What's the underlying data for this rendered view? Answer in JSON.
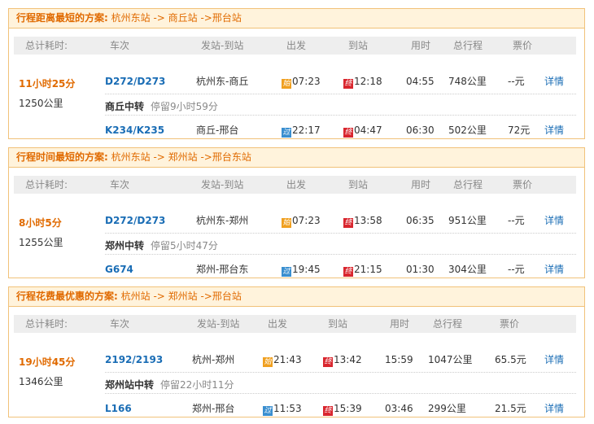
{
  "plans": [
    {
      "title": "行程距离最短的方案:",
      "route": "杭州东站 -> 商丘站 ->邢台站",
      "headers": [
        "总计耗时:",
        "车次",
        "发站-到站",
        "出发",
        "到站",
        "用时",
        "总行程",
        "票价"
      ],
      "total_time": "11小时25分",
      "total_km": "1250公里",
      "transfer_station": "商丘中转",
      "transfer_stay": "停留9小时59分",
      "legs": [
        {
          "train": "D272/D273",
          "stations": "杭州东-商丘",
          "dep_badge": "始",
          "dep": "07:23",
          "arr_badge": "终",
          "arr": "12:18",
          "duration": "04:55",
          "distance": "748公里",
          "price": "--元",
          "detail": "详情"
        },
        {
          "train": "K234/K235",
          "stations": "商丘-邢台",
          "dep_badge": "过",
          "dep": "22:17",
          "arr_badge": "终",
          "arr": "04:47",
          "duration": "06:30",
          "distance": "502公里",
          "price": "72元",
          "detail": "详情"
        }
      ]
    },
    {
      "title": "行程时间最短的方案:",
      "route": "杭州东站 -> 郑州站 ->邢台东站",
      "headers": [
        "总计耗时:",
        "车次",
        "发站-到站",
        "出发",
        "到站",
        "用时",
        "总行程",
        "票价"
      ],
      "total_time": "8小时5分",
      "total_km": "1255公里",
      "transfer_station": "郑州中转",
      "transfer_stay": "停留5小时47分",
      "legs": [
        {
          "train": "D272/D273",
          "stations": "杭州东-郑州",
          "dep_badge": "始",
          "dep": "07:23",
          "arr_badge": "终",
          "arr": "13:58",
          "duration": "06:35",
          "distance": "951公里",
          "price": "--元",
          "detail": "详情"
        },
        {
          "train": "G674",
          "stations": "郑州-邢台东",
          "dep_badge": "过",
          "dep": "19:45",
          "arr_badge": "终",
          "arr": "21:15",
          "duration": "01:30",
          "distance": "304公里",
          "price": "--元",
          "detail": "详情"
        }
      ]
    },
    {
      "title": "行程花费最优惠的方案:",
      "route": "杭州站 -> 郑州站 ->邢台站",
      "headers": [
        "总计耗时:",
        "车次",
        "发站-到站",
        "出发",
        "到站",
        "用时",
        "总行程",
        "票价"
      ],
      "total_time": "19小时45分",
      "total_km": "1346公里",
      "transfer_station": "郑州站中转",
      "transfer_stay": "停留22小时11分",
      "legs": [
        {
          "train": "2192/2193",
          "stations": "杭州-郑州",
          "dep_badge": "始",
          "dep": "21:43",
          "arr_badge": "终",
          "arr": "13:42",
          "duration": "15:59",
          "distance": "1047公里",
          "price": "65.5元",
          "detail": "详情"
        },
        {
          "train": "L166",
          "stations": "郑州-邢台",
          "dep_badge": "过",
          "dep": "11:53",
          "arr_badge": "终",
          "arr": "15:39",
          "duration": "03:46",
          "distance": "299公里",
          "price": "21.5元",
          "detail": "详情"
        }
      ]
    }
  ],
  "colors": {
    "title_orange": "#e06a00",
    "link_blue": "#1a6db5",
    "badge_start": "#f0a020",
    "badge_pass": "#3a8fd0",
    "badge_end": "#d9262e"
  }
}
